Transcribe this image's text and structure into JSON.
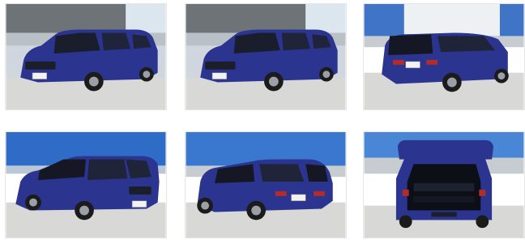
{
  "gallery": {
    "photos": [
      {
        "label": "car-front-three-quarter-left",
        "plate": "",
        "paint": "#2b3590"
      },
      {
        "label": "car-front-three-quarter-left",
        "plate": "",
        "paint": "#2b3590"
      },
      {
        "label": "car-rear-three-quarter-right",
        "plate": "",
        "paint": "#2b3590"
      },
      {
        "label": "car-front-three-quarter-right",
        "plate": "",
        "paint": "#2b3590"
      },
      {
        "label": "car-rear-three-quarter-left",
        "plate": "",
        "paint": "#2b3590"
      },
      {
        "label": "car-rear-tailgate-open",
        "plate": "",
        "paint": "#2b3590"
      }
    ]
  }
}
